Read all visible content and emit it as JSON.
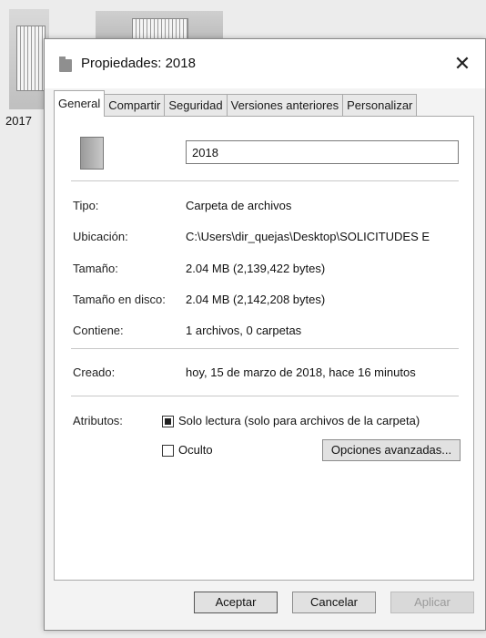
{
  "desktop": {
    "folder_label": "2017"
  },
  "window": {
    "title": "Propiedades: 2018",
    "close_glyph": "✕"
  },
  "tabs": [
    {
      "label": "General",
      "active": true
    },
    {
      "label": "Compartir"
    },
    {
      "label": "Seguridad"
    },
    {
      "label": "Versiones anteriores"
    },
    {
      "label": "Personalizar"
    }
  ],
  "general": {
    "name": "2018",
    "props": {
      "tipo": {
        "label": "Tipo:",
        "value": "Carpeta de archivos"
      },
      "ubicacion": {
        "label": "Ubicación:",
        "value": "C:\\Users\\dir_quejas\\Desktop\\SOLICITUDES E"
      },
      "tamano": {
        "label": "Tamaño:",
        "value": "2.04 MB (2,139,422 bytes)"
      },
      "tamano_disco": {
        "label": "Tamaño en disco:",
        "value": "2.04 MB (2,142,208 bytes)"
      },
      "contiene": {
        "label": "Contiene:",
        "value": "1 archivos, 0 carpetas"
      },
      "creado": {
        "label": "Creado:",
        "value": "hoy, 15 de marzo de 2018, hace 16 minutos"
      }
    },
    "attributes": {
      "label": "Atributos:",
      "read_only": {
        "label": "Solo lectura (solo para archivos de la carpeta)",
        "state": "mixed"
      },
      "hidden": {
        "label": "Oculto",
        "state": "unchecked"
      },
      "advanced_button": "Opciones avanzadas..."
    }
  },
  "footer": {
    "ok": "Aceptar",
    "cancel": "Cancelar",
    "apply": "Aplicar"
  }
}
